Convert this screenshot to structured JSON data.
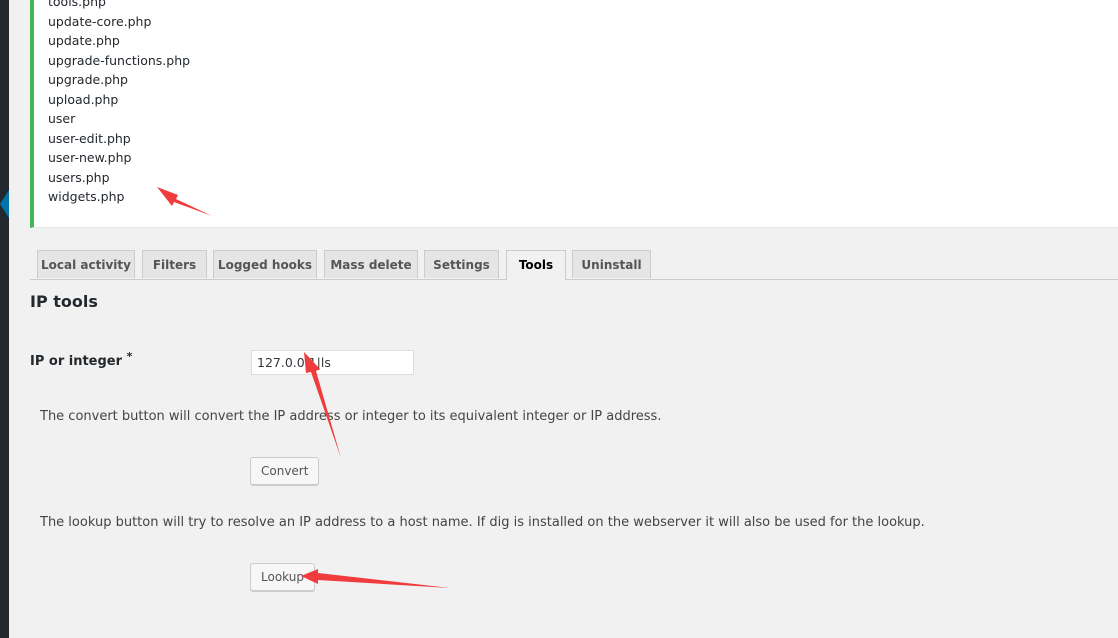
{
  "output": {
    "files": [
      "tools.php",
      "update-core.php",
      "update.php",
      "upgrade-functions.php",
      "upgrade.php",
      "upload.php",
      "user",
      "user-edit.php",
      "user-new.php",
      "users.php",
      "widgets.php"
    ]
  },
  "tabs": [
    {
      "label": "Local activity"
    },
    {
      "label": "Filters"
    },
    {
      "label": "Logged hooks"
    },
    {
      "label": "Mass delete"
    },
    {
      "label": "Settings"
    },
    {
      "label": "Tools",
      "active": true
    },
    {
      "label": "Uninstall"
    }
  ],
  "ip_tools": {
    "title": "IP tools",
    "field_label": "IP or integer",
    "required_marker": "*",
    "ip_value": "127.0.0.1|ls",
    "convert_desc": "The convert button will convert the IP address or integer to its equivalent integer or IP address.",
    "convert_label": "Convert",
    "lookup_desc": "The lookup button will try to resolve an IP address to a host name. If dig is installed on the webserver it will also be used for the lookup.",
    "lookup_label": "Lookup"
  },
  "colors": {
    "accent_green": "#46b450",
    "annotation_red": "#f03c3c",
    "admin_bar": "#23282d",
    "active_indicator": "#0073aa"
  }
}
